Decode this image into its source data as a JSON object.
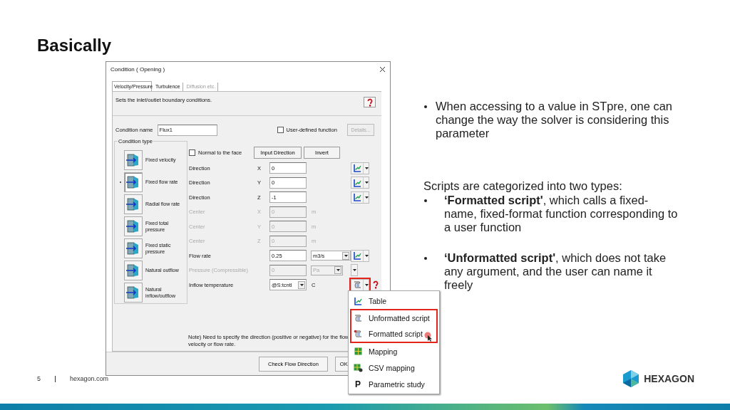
{
  "slide": {
    "title": "Basically",
    "page_number": "5",
    "footer_link": "hexagon.com",
    "logo_text": "HEXAGON"
  },
  "dialog": {
    "title": "Condition ( Opening )",
    "tabs": [
      {
        "label": "Velocity/Pressure",
        "selected": true,
        "disabled": false
      },
      {
        "label": "Turbulence",
        "selected": false,
        "disabled": false
      },
      {
        "label": "Diffusion etc.",
        "selected": false,
        "disabled": true
      }
    ],
    "description": "Sets the inlet/outlet boundary conditions.",
    "condition_name": {
      "label": "Condition name",
      "value": "Flux1"
    },
    "user_defined_function": {
      "label": "User-defined function",
      "checked": false
    },
    "details_button": {
      "label": "Details...",
      "disabled": true
    },
    "condition_type": {
      "title": "Condition type",
      "items": [
        {
          "label": "Fixed velocity",
          "selected": false
        },
        {
          "label": "Fixed flow rate",
          "selected": true
        },
        {
          "label": "Radial flow rate",
          "selected": false
        },
        {
          "label": "Fixed total pressure",
          "selected": false
        },
        {
          "label": "Fixed static pressure",
          "selected": false
        },
        {
          "label": "Natural outflow",
          "selected": false
        },
        {
          "label": "Natural inflow/outflow",
          "selected": false
        }
      ]
    },
    "normal_to_face": {
      "label": "Normal to the face",
      "checked": false
    },
    "direction_buttons": [
      "Input Direction",
      "Invert"
    ],
    "rows": [
      {
        "label": "Direction",
        "axis": "X",
        "field": {
          "kind": "text",
          "value": "0"
        },
        "action": {
          "kind": "table"
        },
        "disabled": false
      },
      {
        "label": "Direction",
        "axis": "Y",
        "field": {
          "kind": "text",
          "value": "0"
        },
        "action": {
          "kind": "table"
        },
        "disabled": false
      },
      {
        "label": "Direction",
        "axis": "Z",
        "field": {
          "kind": "text",
          "value": "-1"
        },
        "action": {
          "kind": "table"
        },
        "disabled": false
      },
      {
        "label": "Center",
        "axis": "X",
        "field": {
          "kind": "text",
          "value": "0"
        },
        "unit": {
          "kind": "text",
          "label": "m"
        },
        "disabled": true
      },
      {
        "label": "Center",
        "axis": "Y",
        "field": {
          "kind": "text",
          "value": "0"
        },
        "unit": {
          "kind": "text",
          "label": "m"
        },
        "disabled": true
      },
      {
        "label": "Center",
        "axis": "Z",
        "field": {
          "kind": "text",
          "value": "0"
        },
        "unit": {
          "kind": "text",
          "label": "m"
        },
        "disabled": true
      },
      {
        "label": "Flow rate",
        "field": {
          "kind": "text",
          "value": "0.25"
        },
        "unit": {
          "kind": "select",
          "label": "m3/s"
        },
        "action": {
          "kind": "table"
        },
        "disabled": false
      },
      {
        "label": "Pressure (Compressible)",
        "field": {
          "kind": "text",
          "value": "0"
        },
        "unit": {
          "kind": "select",
          "label": "Pa"
        },
        "action": {
          "kind": "caret"
        },
        "disabled": true
      },
      {
        "label": "Inflow temperature",
        "field": {
          "kind": "combo",
          "value": "@S:tcntl"
        },
        "unit": {
          "kind": "text",
          "label": "C"
        },
        "action": {
          "kind": "script",
          "outlined": true,
          "help": true
        },
        "disabled": false
      }
    ],
    "note": "Note) Need to specify the direction (positive or negative) for the flow velocity or flow rate.",
    "buttons": [
      "Check Flow Direction",
      "OK"
    ]
  },
  "menu": {
    "items": [
      {
        "kind": "table",
        "label": "Table",
        "outlined": false,
        "hovered": false
      },
      {
        "kind": "script",
        "label": "Unformatted script",
        "outlined": true,
        "hovered": false
      },
      {
        "kind": "formatted-script",
        "label": "Formatted script",
        "outlined": true,
        "hovered": true
      },
      {
        "kind": "mapping",
        "label": "Mapping",
        "outlined": false,
        "hovered": false
      },
      {
        "kind": "csv-mapping",
        "label": "CSV mapping",
        "outlined": false,
        "hovered": false
      },
      {
        "kind": "glyph",
        "glyph": "P",
        "label": "Parametric study",
        "outlined": false,
        "hovered": false
      }
    ]
  },
  "notes": [
    {
      "kind": "bullet",
      "text": "When accessing to a value in STpre, one can change the way the solver is considering this parameter"
    },
    {
      "kind": "plain",
      "text": "Scripts are categorized into two types:"
    },
    {
      "kind": "bullet",
      "text": "**‘Formatted script'**, which calls a fixed-name, fixed-format function corresponding to a user function"
    },
    {
      "kind": "bullet",
      "text": "**‘Unformatted script'**, which does not take any argument, and the user can name it freely"
    }
  ]
}
